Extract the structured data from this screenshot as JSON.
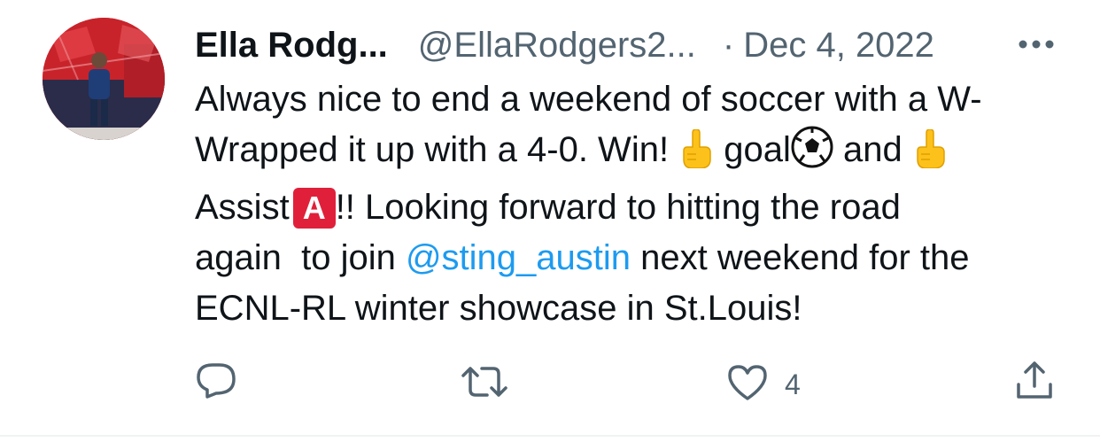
{
  "tweet": {
    "author_name": "Ella Rodg...",
    "author_handle": "@EllaRodgers2...",
    "separator": "·",
    "date": "Dec 4, 2022",
    "text_lines": {
      "line1": "Always nice to end a weekend of soccer with a W-",
      "line2a": "Wrapped it up with a 4-0. Win! ",
      "line2b": " goal",
      "line2c": " and ",
      "line3a": "Assist",
      "line3badge": "A",
      "line3b": "!! Looking forward to hitting the road",
      "line4a": "again  to join ",
      "mention": "@sting_austin",
      "line4b": " next weekend for the",
      "line5": "ECNL-RL winter showcase in St.Louis!"
    },
    "emojis": [
      "point-up-emoji",
      "soccer-ball-emoji",
      "point-up-emoji",
      "a-button-emoji"
    ]
  },
  "actions": {
    "reply": {
      "icon": "reply-icon",
      "count": ""
    },
    "retweet": {
      "icon": "retweet-icon",
      "count": ""
    },
    "like": {
      "icon": "heart-icon",
      "count": "4"
    },
    "share": {
      "icon": "share-icon",
      "count": ""
    }
  },
  "colors": {
    "name": "#0f1419",
    "secondary": "#536471",
    "mention": "#1d9bf0",
    "badge": "#e0203a"
  }
}
